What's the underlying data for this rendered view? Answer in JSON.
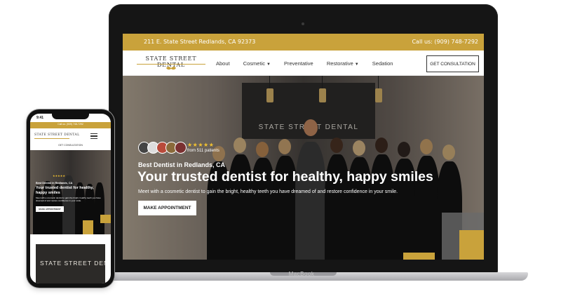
{
  "laptop": {
    "brand_label": "MacBook"
  },
  "site": {
    "topbar": {
      "address": "211 E. State Street Redlands, CA 92373",
      "call": "Call us: (909) 748-7292"
    },
    "logo": "STATE STREET DENTAL",
    "nav": {
      "items": [
        {
          "label": "About",
          "has_caret": false
        },
        {
          "label": "Cosmetic",
          "has_caret": true
        },
        {
          "label": "Preventative",
          "has_caret": false
        },
        {
          "label": "Restorative",
          "has_caret": true
        },
        {
          "label": "Sedation",
          "has_caret": false
        }
      ],
      "cta": "GET CONSULTATION"
    },
    "hero": {
      "sign": "STATE STREET DENTAL",
      "stars": "★★★★★",
      "reviews": "from 511 patients",
      "kicker": "Best Dentist in Redlands, CA",
      "title": "Your trusted dentist for healthy, happy smiles",
      "subtitle": "Meet with a cosmetic dentist to gain the bright, healthy teeth you have dreamed of and restore confidence in your smile.",
      "button": "MAKE APPOINTMENT"
    }
  },
  "phone": {
    "time": "9:41",
    "bar_text": "Call us: (909) 748-7292",
    "logo": "STATE STREET DENTAL",
    "consult": "GET CONSULTATION",
    "stars": "★★★★★",
    "kicker": "Best Dentist in Redlands, CA",
    "title": "Your trusted dentist for healthy, happy smiles",
    "subtitle": "Meet with a cosmetic dentist to gain the bright, healthy teeth you have dreamed of and restore confidence in your smile.",
    "button": "MAKE APPOINTMENT",
    "sign": "STATE STREET DENTAL"
  },
  "colors": {
    "gold": "#c9a23b",
    "dark": "#151515"
  }
}
